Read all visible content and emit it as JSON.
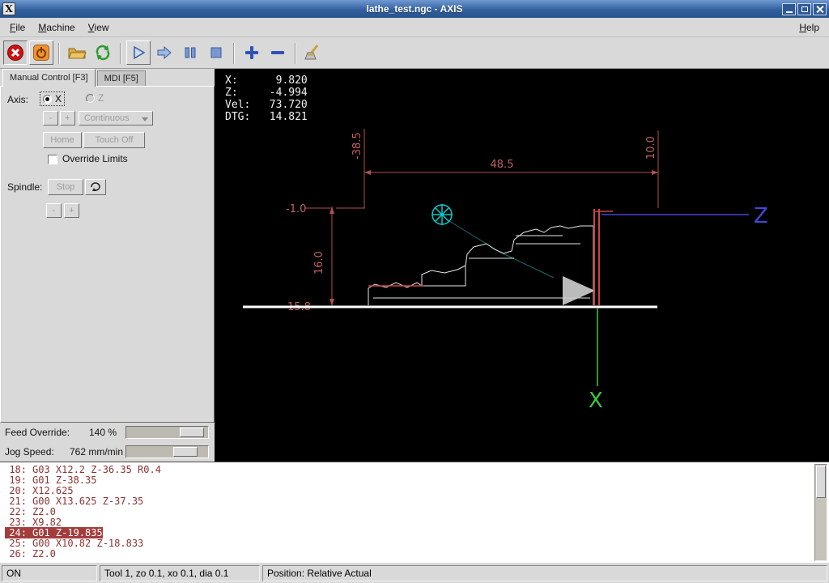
{
  "window": {
    "title": "lathe_test.ngc - AXIS"
  },
  "menubar": {
    "items": [
      "File",
      "Machine",
      "View"
    ],
    "help": "Help"
  },
  "toolbar": {
    "icons": [
      "estop-icon",
      "power-icon",
      "open-file-icon",
      "reload-icon",
      "run-icon",
      "step-icon",
      "pause-icon",
      "stop-icon",
      "zoom-in-icon",
      "zoom-out-icon",
      "clear-plot-icon"
    ]
  },
  "tabs": {
    "manual": "Manual Control [F3]",
    "mdi": "MDI [F5]"
  },
  "manual": {
    "axis_label": "Axis:",
    "axis_x": "X",
    "axis_z": "Z",
    "minus": "-",
    "plus": "+",
    "jog_mode": "Continuous",
    "home": "Home",
    "touch_off": "Touch Off",
    "override_limits": "Override Limits",
    "spindle_label": "Spindle:",
    "spindle_stop": "Stop"
  },
  "overrides": {
    "feed_label": "Feed Override:",
    "feed_value": "140 %",
    "jog_label": "Jog Speed:",
    "jog_value": "762 mm/min"
  },
  "dro": {
    "line1": "X:      9.820",
    "line2": "Z:     -4.994",
    "line3": "Vel:   73.720",
    "line4": "DTG:   14.821"
  },
  "plot": {
    "dim_left": "-38.5",
    "dim_width": "48.5",
    "dim_right": "10.0",
    "dim_top": "-1.0",
    "dim_height": "16.0",
    "dim_bottom": "15.8",
    "axis_z_label": "Z",
    "axis_x_label": "X"
  },
  "program": {
    "active_line": "24",
    "lines": [
      {
        "num": "18:",
        "code": "G03 X12.2 Z-36.35 R0.4"
      },
      {
        "num": "19:",
        "code": "G01 Z-38.35"
      },
      {
        "num": "20:",
        "code": "X12.625"
      },
      {
        "num": "21:",
        "code": "G00 X13.625 Z-37.35"
      },
      {
        "num": "22:",
        "code": "Z2.0"
      },
      {
        "num": "23:",
        "code": "X9.82"
      },
      {
        "num": "24:",
        "code": "G01 Z-19.835"
      },
      {
        "num": "25:",
        "code": "G00 X10.82 Z-18.833"
      },
      {
        "num": "26:",
        "code": "Z2.0"
      }
    ]
  },
  "statusbar": {
    "power": "ON",
    "tool": "Tool 1, zo 0.1, xo 0.1, dia 0.1",
    "position": "Position: Relative Actual"
  },
  "colors": {
    "titlebar": "#33619e",
    "canvas_bg": "#000000",
    "dimension_red": "#b05050",
    "axis_z_blue": "#4646d8",
    "axis_x_green": "#3ec83e",
    "marker_cyan": "#00cccc",
    "highlight_bg": "#a33d3d",
    "program_text": "#8b3333"
  }
}
